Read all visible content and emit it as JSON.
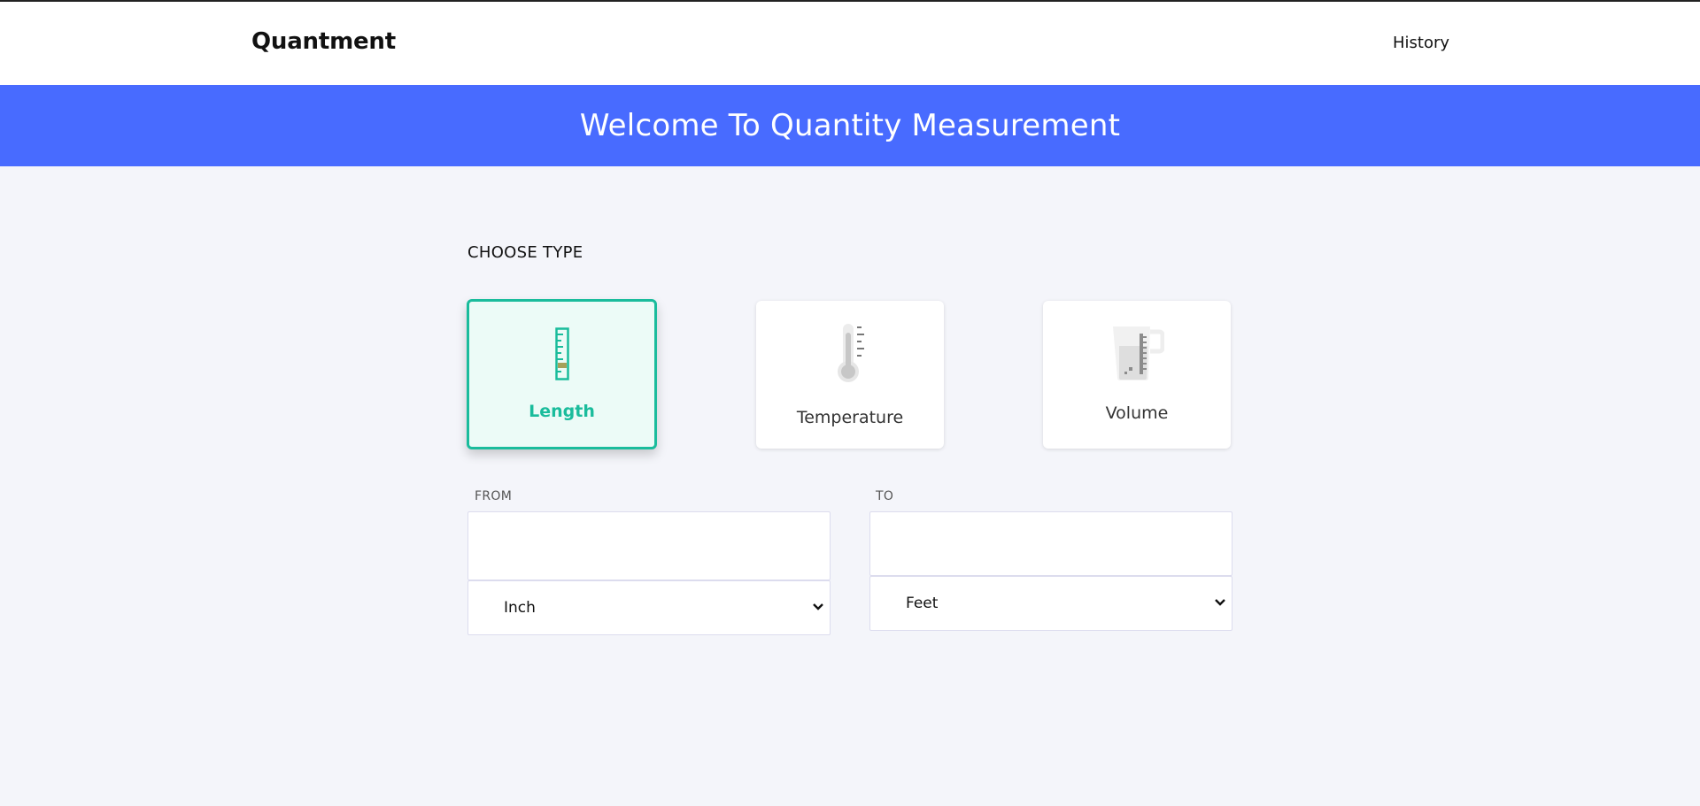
{
  "navbar": {
    "brand": "Quantment",
    "history_link": "History"
  },
  "hero": {
    "title": "Welcome To Quantity Measurement"
  },
  "main": {
    "choose_type_label": "CHOOSE TYPE",
    "types": [
      {
        "label": "Length",
        "icon": "ruler-icon",
        "selected": true
      },
      {
        "label": "Temperature",
        "icon": "thermometer-icon",
        "selected": false
      },
      {
        "label": "Volume",
        "icon": "measuring-jug-icon",
        "selected": false
      }
    ],
    "from": {
      "label": "FROM",
      "value": "",
      "unit": "Inch"
    },
    "to": {
      "label": "TO",
      "value": "",
      "unit": "Feet"
    }
  },
  "colors": {
    "accent": "#486bff",
    "selected": "#1abc9c",
    "background": "#f4f5fa"
  }
}
